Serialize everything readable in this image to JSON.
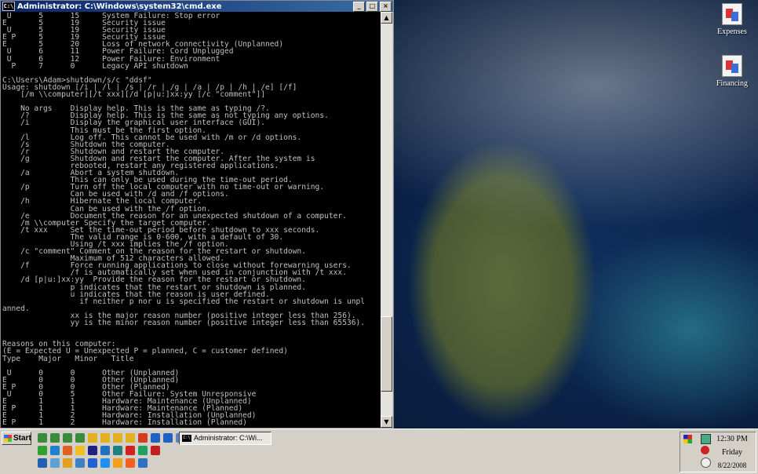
{
  "window": {
    "title": "Administrator: C:\\Windows\\system32\\cmd.exe",
    "icon_label": "C:\\",
    "minimize": "_",
    "maximize": "□",
    "close": "×"
  },
  "console_lines": [
    " U      5      15     System Failure: Stop error",
    "E       5      19     Security issue",
    " U      5      19     Security issue",
    "E P     5      19     Security issue",
    "E       5      20     Loss of network connectivity (Unplanned)",
    " U      6      11     Power Failure: Cord Unplugged",
    " U      6      12     Power Failure: Environment",
    "  P     7      0      Legacy API shutdown",
    "",
    "C:\\Users\\Adam>shutdown/s/c \"ddsf\"",
    "Usage: shutdown [/i | /l | /s | /r | /g | /a | /p | /h | /e] [/f]",
    "    [/m \\\\computer][/t xxx][/d [p|u:]xx:yy [/c \"comment\"]]",
    "",
    "    No args    Display help. This is the same as typing /?.",
    "    /?         Display help. This is the same as not typing any options.",
    "    /i         Display the graphical user interface (GUI).",
    "               This must be the first option.",
    "    /l         Log off. This cannot be used with /m or /d options.",
    "    /s         Shutdown the computer.",
    "    /r         Shutdown and restart the computer.",
    "    /g         Shutdown and restart the computer. After the system is",
    "               rebooted, restart any registered applications.",
    "    /a         Abort a system shutdown.",
    "               This can only be used during the time-out period.",
    "    /p         Turn off the local computer with no time-out or warning.",
    "               Can be used with /d and /f options.",
    "    /h         Hibernate the local computer.",
    "               Can be used with the /f option.",
    "    /e         Document the reason for an unexpected shutdown of a computer.",
    "    /m \\\\computer Specify the target computer.",
    "    /t xxx     Set the time-out period before shutdown to xxx seconds.",
    "               The valid range is 0-600, with a default of 30.",
    "               Using /t xxx implies the /f option.",
    "    /c \"comment\" Comment on the reason for the restart or shutdown.",
    "               Maximum of 512 characters allowed.",
    "    /f         Force running applications to close without forewarning users.",
    "               /f is automatically set when used in conjunction with /t xxx.",
    "    /d [p|u:]xx:yy  Provide the reason for the restart or shutdown.",
    "               p indicates that the restart or shutdown is planned.",
    "               u indicates that the reason is user defined.",
    "                 if neither p nor u is specified the restart or shutdown is unpl",
    "anned.",
    "               xx is the major reason number (positive integer less than 256).",
    "               yy is the minor reason number (positive integer less than 65536).",
    "",
    "",
    "Reasons on this computer:",
    "(E = Expected U = Unexpected P = planned, C = customer defined)",
    "Type    Major   Minor   Title",
    "",
    " U      0      0      Other (Unplanned)",
    "E       0      0      Other (Unplanned)",
    "E P     0      0      Other (Planned)",
    " U      0      5      Other Failure: System Unresponsive",
    "E       1      1      Hardware: Maintenance (Unplanned)",
    "E P     1      1      Hardware: Maintenance (Planned)",
    "E       1      2      Hardware: Installation (Unplanned)",
    "E P     1      2      Hardware: Installation (Planned)"
  ],
  "scrollbar": {
    "up": "▲",
    "down": "▼"
  },
  "desktop_icons": [
    {
      "label": "Expenses",
      "icon": "document-icon"
    },
    {
      "label": "Financing",
      "icon": "document-icon"
    }
  ],
  "taskbar": {
    "start_label": "Start",
    "task_button": "Administrator: C:\\Wi...",
    "quick_launch_colors": [
      [
        "#3a8a3a",
        "#3a8a3a",
        "#3a8a3a",
        "#3a8a3a",
        "#e0b020",
        "#e0b020",
        "#e0b020",
        "#e0b020",
        "#d04020",
        "#2060c0",
        "#2060c0",
        "#6080c0"
      ],
      [
        "#30a030",
        "#2080d0",
        "#e06020",
        "#f0c020",
        "#202080",
        "#2070c0",
        "#208080",
        "#d02020",
        "#20a060",
        "#c02020"
      ],
      [
        "#2060b0",
        "#60a0d0",
        "#e0a020",
        "#4080c0",
        "#2060d0",
        "#2090f0",
        "#f0a020",
        "#f06020",
        "#3070c0"
      ]
    ],
    "clock": {
      "time": "12:30 PM",
      "day": "Friday",
      "date": "8/22/2008"
    }
  }
}
